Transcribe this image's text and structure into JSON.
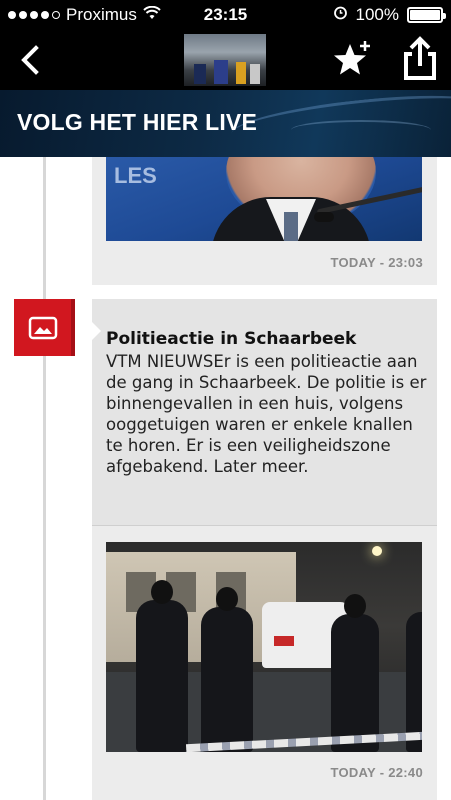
{
  "status_bar": {
    "carrier": "Proximus",
    "time": "23:15",
    "battery": "100%",
    "battery_level": 1.0,
    "signal_bars_filled": 4,
    "signal_bars_total": 5
  },
  "nav": {
    "back_icon": "chevron-left-icon",
    "thumbnail_icon": "live-thumbnail",
    "favorite_icon": "star-plus-icon",
    "share_icon": "share-icon"
  },
  "banner": {
    "title": "VOLG HET HIER LIVE"
  },
  "feed": {
    "items": [
      {
        "timestamp": "TODAY - 23:03",
        "image_text": "LES"
      },
      {
        "marker_icon": "image-icon",
        "title": "Politieactie in Schaarbeek",
        "body": "VTM NIEUWSEr is een politieactie aan de gang in Schaarbeek. De politie is er binnengevallen in een huis, volgens ooggetuigen waren er enkele knallen te horen. Er is een veiligheidszone afgebakend. Later meer.",
        "timestamp": "TODAY - 22:40"
      }
    ]
  },
  "colors": {
    "marker_red": "#d1171f",
    "banner_navy": "#0d2a45",
    "card_bg": "#ececec",
    "timestamp_gray": "#8a8a8a"
  }
}
